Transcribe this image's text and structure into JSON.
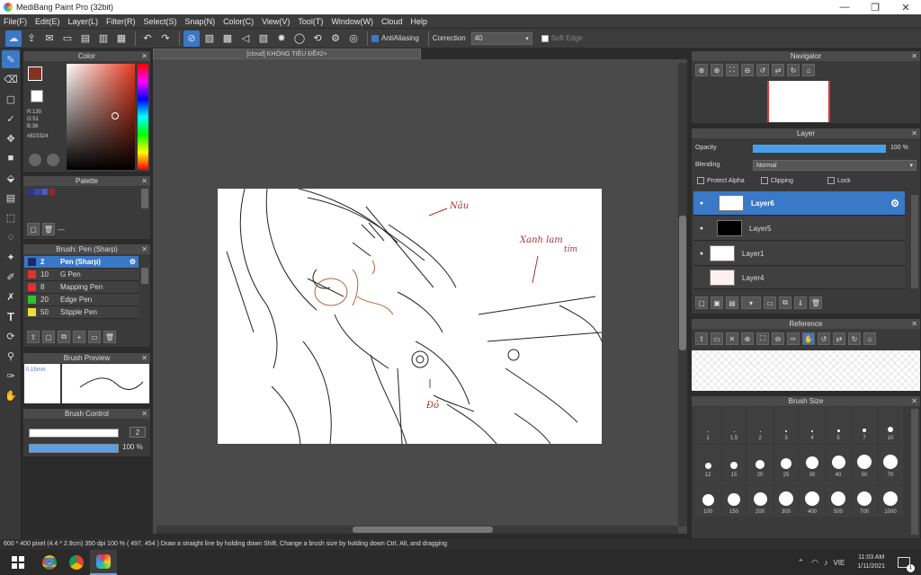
{
  "window": {
    "title": "MediBang Paint Pro (32bit)",
    "minimize": "—",
    "restore": "❐",
    "close": "✕"
  },
  "menu": [
    "File(F)",
    "Edit(E)",
    "Layer(L)",
    "Filter(R)",
    "Select(S)",
    "Snap(N)",
    "Color(C)",
    "View(V)",
    "Tool(T)",
    "Window(W)",
    "Cloud",
    "Help"
  ],
  "toolbar": {
    "antialiasing": "AntiAliasing",
    "correction_label": "Correction",
    "correction_value": "40",
    "soft_edge": "Soft Edge"
  },
  "document": {
    "tab_title": "[cloud] KHÔNG TIÊU ĐỀ#2+"
  },
  "color_panel": {
    "title": "Color",
    "r": "R:130",
    "g": "G:51",
    "b": "B:36",
    "hex": "#823324",
    "fg_color": "#823324",
    "bg_color": "#ffffff"
  },
  "palette_panel": {
    "title": "Palette",
    "dots": "---",
    "swatches": [
      "#2a3a8a",
      "#3a4aa8",
      "#4a5ac0",
      "#8a2a2a"
    ]
  },
  "brush_panel": {
    "title": "Brush: Pen (Sharp)",
    "items": [
      {
        "num": "2",
        "name": "Pen (Sharp)",
        "color": "#1b2a6b"
      },
      {
        "num": "10",
        "name": "G Pen",
        "color": "#e03030"
      },
      {
        "num": "8",
        "name": "Mapping Pen",
        "color": "#e03030"
      },
      {
        "num": "20",
        "name": "Edge Pen",
        "color": "#30c030"
      },
      {
        "num": "50",
        "name": "Stipple Pen",
        "color": "#e8e030"
      }
    ]
  },
  "brush_preview": {
    "title": "Brush Preview",
    "size": "0.15mm"
  },
  "brush_control": {
    "title": "Brush Control",
    "size_value": "2",
    "opacity_value": "100 %"
  },
  "navigator": {
    "title": "Navigator"
  },
  "layer_panel": {
    "title": "Layer",
    "opacity_label": "Opacity",
    "opacity_value": "100 %",
    "opacity_fraction": 1.0,
    "blending_label": "Blending",
    "blending_value": "Normal",
    "protect_alpha": "Protect Alpha",
    "clipping": "Clipping",
    "lock": "Lock",
    "layers": [
      {
        "name": "Layer6",
        "selected": true
      },
      {
        "name": "Layer5",
        "selected": false
      },
      {
        "name": "Layer1",
        "selected": false
      },
      {
        "name": "Layer4",
        "selected": false
      }
    ]
  },
  "reference": {
    "title": "Reference"
  },
  "brush_size": {
    "title": "Brush Size",
    "sizes": [
      "1",
      "1.5",
      "2",
      "3",
      "4",
      "5",
      "7",
      "10",
      "12",
      "15",
      "20",
      "25",
      "30",
      "40",
      "50",
      "70",
      "100",
      "150",
      "200",
      "300",
      "400",
      "500",
      "700",
      "1000"
    ]
  },
  "canvas_text": {
    "note1": "Nâu",
    "note2": "Xanh lam",
    "note3": "tím",
    "note4": "Đỏ"
  },
  "status": {
    "text": "600 * 400 pixel   (4.4 * 2.9cm)   350 dpi   100 %   ( 497, 454 )   Draw a straight line by holding down Shift, Change a brush size by holding down Ctrl, Alt, and dragging"
  },
  "taskbar": {
    "lang": "VIE",
    "time": "11:03 AM",
    "date": "1/11/2021",
    "notif": "1"
  }
}
